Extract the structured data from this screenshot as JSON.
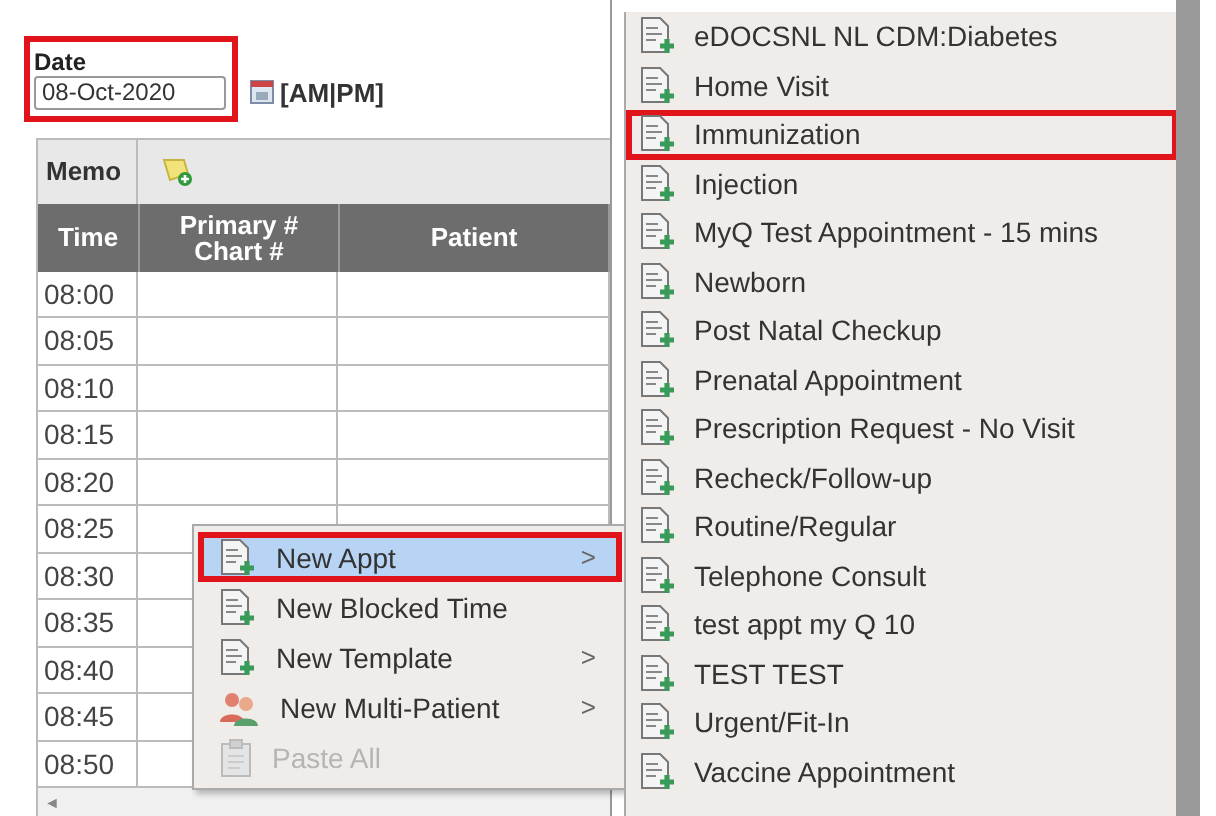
{
  "date_picker": {
    "label": "Date",
    "value": "08-Oct-2020",
    "highlighted": true,
    "ampm": "[AM|PM]"
  },
  "schedule": {
    "memo_label": "Memo",
    "columns": [
      {
        "label": "Time"
      },
      {
        "label": "Primary #\nChart #"
      },
      {
        "label": "Patient"
      }
    ],
    "rows": [
      {
        "time": "08:00"
      },
      {
        "time": "08:05"
      },
      {
        "time": "08:10"
      },
      {
        "time": "08:15"
      },
      {
        "time": "08:20"
      },
      {
        "time": "08:25"
      },
      {
        "time": "08:30"
      },
      {
        "time": "08:35"
      },
      {
        "time": "08:40"
      },
      {
        "time": "08:45"
      },
      {
        "time": "08:50"
      }
    ],
    "scroll_arrow": "◄"
  },
  "context_menu": {
    "items": [
      {
        "kind": "document",
        "label": "New Appt",
        "submenu": true,
        "selected": true,
        "disabled": false
      },
      {
        "kind": "document",
        "label": "New Blocked Time",
        "submenu": false,
        "selected": false,
        "disabled": false
      },
      {
        "kind": "document",
        "label": "New Template",
        "submenu": true,
        "selected": false,
        "disabled": false
      },
      {
        "kind": "people",
        "label": "New Multi-Patient",
        "submenu": true,
        "selected": false,
        "disabled": false
      },
      {
        "kind": "paste",
        "label": "Paste All",
        "submenu": false,
        "selected": false,
        "disabled": true
      }
    ],
    "submenu_arrow": ">"
  },
  "appointment_types": [
    {
      "label": "eDOCSNL NL CDM:Diabetes",
      "highlighted": false
    },
    {
      "label": "Home Visit",
      "highlighted": false
    },
    {
      "label": "Immunization",
      "highlighted": true
    },
    {
      "label": "Injection",
      "highlighted": false
    },
    {
      "label": "MyQ Test Appointment - 15 mins",
      "highlighted": false
    },
    {
      "label": "Newborn",
      "highlighted": false
    },
    {
      "label": "Post Natal Checkup",
      "highlighted": false
    },
    {
      "label": "Prenatal Appointment",
      "highlighted": false
    },
    {
      "label": "Prescription Request - No Visit",
      "highlighted": false
    },
    {
      "label": "Recheck/Follow-up",
      "highlighted": false
    },
    {
      "label": "Routine/Regular",
      "highlighted": false
    },
    {
      "label": "Telephone Consult",
      "highlighted": false
    },
    {
      "label": "test appt my Q 10",
      "highlighted": false
    },
    {
      "label": "TEST TEST",
      "highlighted": false
    },
    {
      "label": "Urgent/Fit-In",
      "highlighted": false
    },
    {
      "label": "Vaccine Appointment",
      "highlighted": false
    }
  ]
}
